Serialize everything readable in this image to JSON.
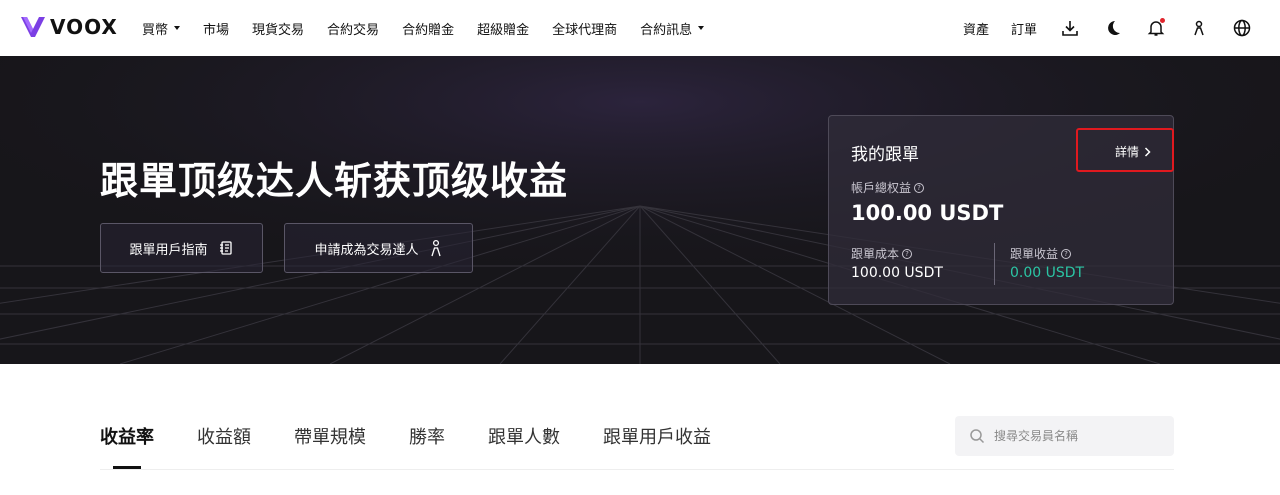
{
  "brand": {
    "name": "VOOX",
    "accent": "#7b3fe4"
  },
  "nav": {
    "items": [
      {
        "label": "買幣",
        "dropdown": true
      },
      {
        "label": "市場",
        "dropdown": false
      },
      {
        "label": "現貨交易",
        "dropdown": false
      },
      {
        "label": "合約交易",
        "dropdown": false
      },
      {
        "label": "合約贈金",
        "dropdown": false
      },
      {
        "label": "超級贈金",
        "dropdown": false
      },
      {
        "label": "全球代理商",
        "dropdown": false
      },
      {
        "label": "合約訊息",
        "dropdown": true
      }
    ],
    "right": {
      "assets": "資產",
      "orders": "訂單",
      "icons": [
        "download-icon",
        "moon-icon",
        "bell-icon",
        "user-icon",
        "globe-icon"
      ]
    }
  },
  "hero": {
    "title": "跟單顶级达人斩获顶级收益",
    "guide_button": "跟單用戶指南",
    "apply_button": "申請成為交易達人"
  },
  "card": {
    "title": "我的跟單",
    "details_link": "詳情",
    "total_label": "帳戶總权益",
    "total_value": "100.00 USDT",
    "cost_label": "跟單成本",
    "cost_value": "100.00 USDT",
    "profit_label": "跟單收益",
    "profit_value": "0.00 USDT",
    "profit_color": "#2bc5a4",
    "highlight_color": "#e0191f"
  },
  "tabs": [
    {
      "label": "收益率",
      "active": true
    },
    {
      "label": "收益額",
      "active": false
    },
    {
      "label": "帶單規模",
      "active": false
    },
    {
      "label": "勝率",
      "active": false
    },
    {
      "label": "跟單人數",
      "active": false
    },
    {
      "label": "跟單用戶收益",
      "active": false
    }
  ],
  "search": {
    "placeholder": "搜尋交易員名稱",
    "value": ""
  }
}
